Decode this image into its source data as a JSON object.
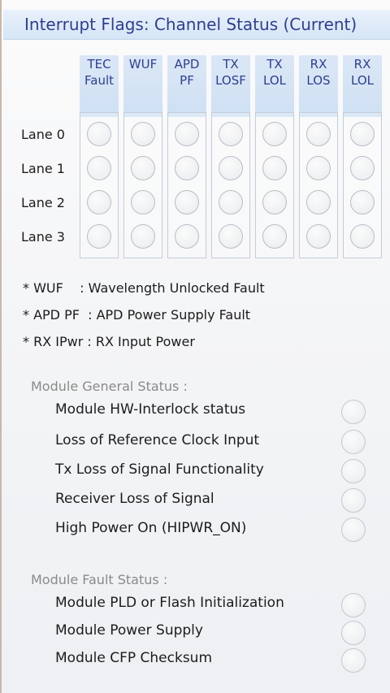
{
  "header": {
    "title": "Interrupt Flags: Channel Status (Current)"
  },
  "columns": [
    {
      "line1": "TEC",
      "line2": "Fault"
    },
    {
      "line1": "WUF",
      "line2": ""
    },
    {
      "line1": "APD",
      "line2": "PF"
    },
    {
      "line1": "TX",
      "line2": "LOSF"
    },
    {
      "line1": "TX",
      "line2": "LOL"
    },
    {
      "line1": "RX",
      "line2": "LOS"
    },
    {
      "line1": "RX",
      "line2": "LOL"
    }
  ],
  "lanes": [
    "Lane 0",
    "Lane 1",
    "Lane 2",
    "Lane 3"
  ],
  "legend": [
    "* WUF    : Wavelength Unlocked Fault",
    "* APD PF  : APD Power Supply Fault",
    "* RX IPwr : RX Input Power"
  ],
  "general_status": {
    "title": "Module General Status :",
    "items": [
      "Module HW-Interlock status",
      "Loss of Reference Clock Input",
      "Tx Loss of Signal Functionality",
      "Receiver Loss of Signal",
      "High Power On (HIPWR_ON)"
    ]
  },
  "fault_status": {
    "title": "Module Fault Status :",
    "items": [
      "Module PLD or Flash Initialization",
      "Module Power Supply",
      "Module CFP Checksum"
    ]
  }
}
